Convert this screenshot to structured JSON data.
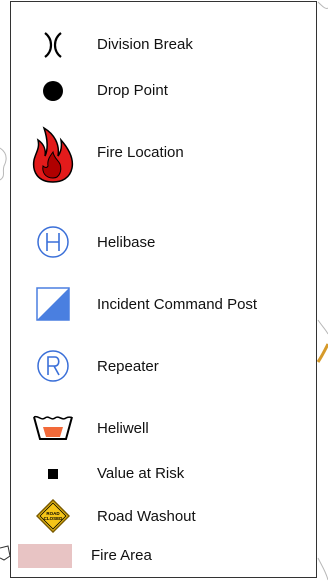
{
  "legend": {
    "items": [
      {
        "label": "Division Break",
        "icon": "division-break-icon"
      },
      {
        "label": "Drop Point",
        "icon": "drop-point-icon"
      },
      {
        "label": "Fire Location",
        "icon": "fire-location-icon"
      },
      {
        "label": "Helibase",
        "icon": "helibase-icon"
      },
      {
        "label": "Incident Command Post",
        "icon": "incident-command-post-icon"
      },
      {
        "label": "Repeater",
        "icon": "repeater-icon"
      },
      {
        "label": "Heliwell",
        "icon": "heliwell-icon"
      },
      {
        "label": "Value at Risk",
        "icon": "value-at-risk-icon"
      },
      {
        "label": "Road Washout",
        "icon": "road-washout-icon"
      },
      {
        "label": "Fire Area",
        "icon": "fire-area-swatch"
      }
    ],
    "road_sign_text": [
      "ROAD",
      "CLOSED"
    ]
  },
  "colors": {
    "fire_red": "#e31b1b",
    "helibase_blue": "#3a6fd8",
    "icp_blue": "#4a7fe0",
    "heliwell_orange": "#f26a3a",
    "sign_yellow": "#f5c518",
    "fire_area_pink": "#e8c4c4"
  }
}
